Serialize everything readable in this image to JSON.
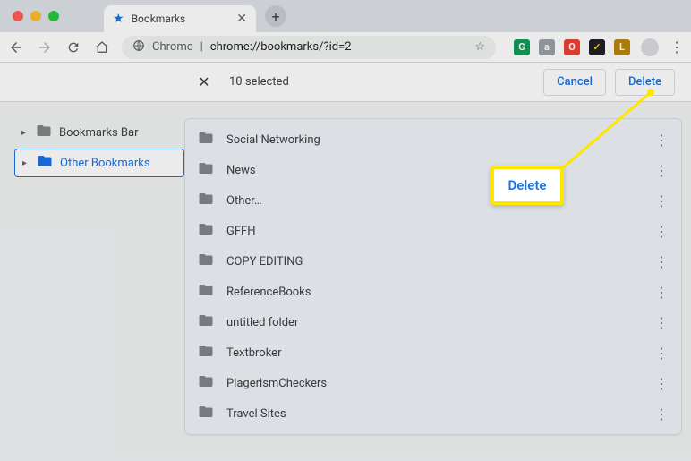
{
  "tab": {
    "title": "Bookmarks"
  },
  "omnibox": {
    "scheme_label": "Chrome",
    "url": "chrome://bookmarks/?id=2"
  },
  "selection": {
    "count_label": "10 selected",
    "cancel": "Cancel",
    "delete": "Delete"
  },
  "sidebar": {
    "items": [
      {
        "label": "Bookmarks Bar",
        "selected": false
      },
      {
        "label": "Other Bookmarks",
        "selected": true
      }
    ]
  },
  "folders": [
    {
      "name": "Social Networking"
    },
    {
      "name": "News"
    },
    {
      "name": "Other…"
    },
    {
      "name": "GFFH"
    },
    {
      "name": "COPY EDITING"
    },
    {
      "name": "ReferenceBooks"
    },
    {
      "name": "untitled folder"
    },
    {
      "name": "Textbroker"
    },
    {
      "name": "PlagerismCheckers"
    },
    {
      "name": "Travel Sites"
    }
  ],
  "extensions": [
    {
      "id": "g",
      "glyph": "G"
    },
    {
      "id": "a",
      "glyph": "a"
    },
    {
      "id": "o",
      "glyph": "O"
    },
    {
      "id": "ev",
      "glyph": "✓"
    },
    {
      "id": "l",
      "glyph": "L"
    }
  ],
  "callout": {
    "label": "Delete"
  }
}
